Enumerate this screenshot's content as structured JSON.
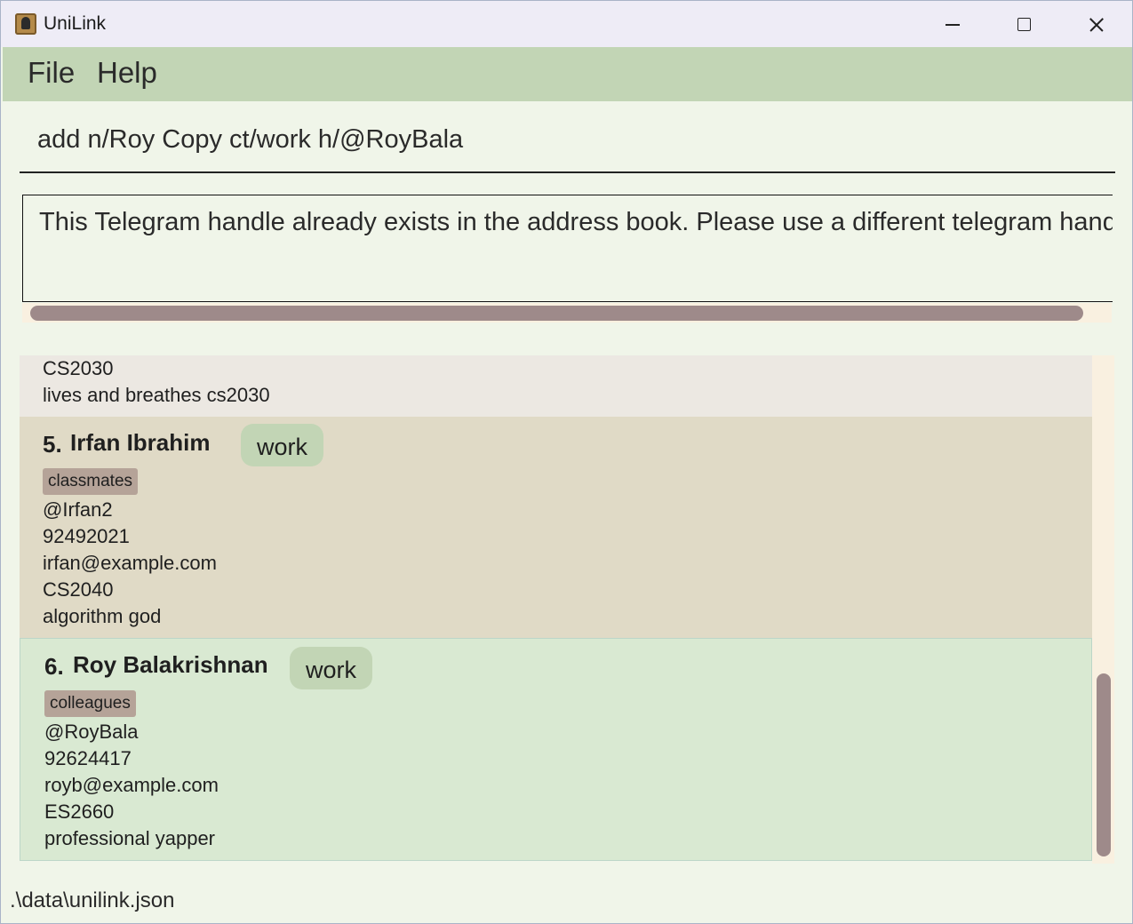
{
  "window": {
    "title": "UniLink",
    "icons": {
      "app": "address-book-icon",
      "minimize": "minimize-icon",
      "maximize": "maximize-icon",
      "close": "close-icon"
    }
  },
  "menu": {
    "file": "File",
    "help": "Help"
  },
  "command": {
    "value": "add n/Roy Copy ct/work h/@RoyBala"
  },
  "result": {
    "text": "This Telegram handle already exists in the address book. Please use a different telegram handle"
  },
  "persons": {
    "previous": {
      "module": "CS2030",
      "note": "lives and breathes cs2030"
    },
    "p5": {
      "index": "5.",
      "name": "Irfan Ibrahim",
      "contact_type": "work",
      "tag": "classmates",
      "telegram": "@Irfan2",
      "phone": "92492021",
      "email": "irfan@example.com",
      "module": "CS2040",
      "note": "algorithm god"
    },
    "p6": {
      "index": "6.",
      "name": "Roy Balakrishnan",
      "contact_type": "work",
      "tag": "colleagues",
      "telegram": "@RoyBala",
      "phone": "92624417",
      "email": "royb@example.com",
      "module": "ES2660",
      "note": "professional yapper"
    }
  },
  "status": {
    "path": ".\\data\\unilink.json"
  },
  "colors": {
    "background": "#f0f5e9",
    "menubar": "#c2d5b5",
    "card_alt": "#e0dac6",
    "card_selected": "#d9e9d2",
    "tag": "#b5a398",
    "scrollbar": "#9e8a8a"
  }
}
